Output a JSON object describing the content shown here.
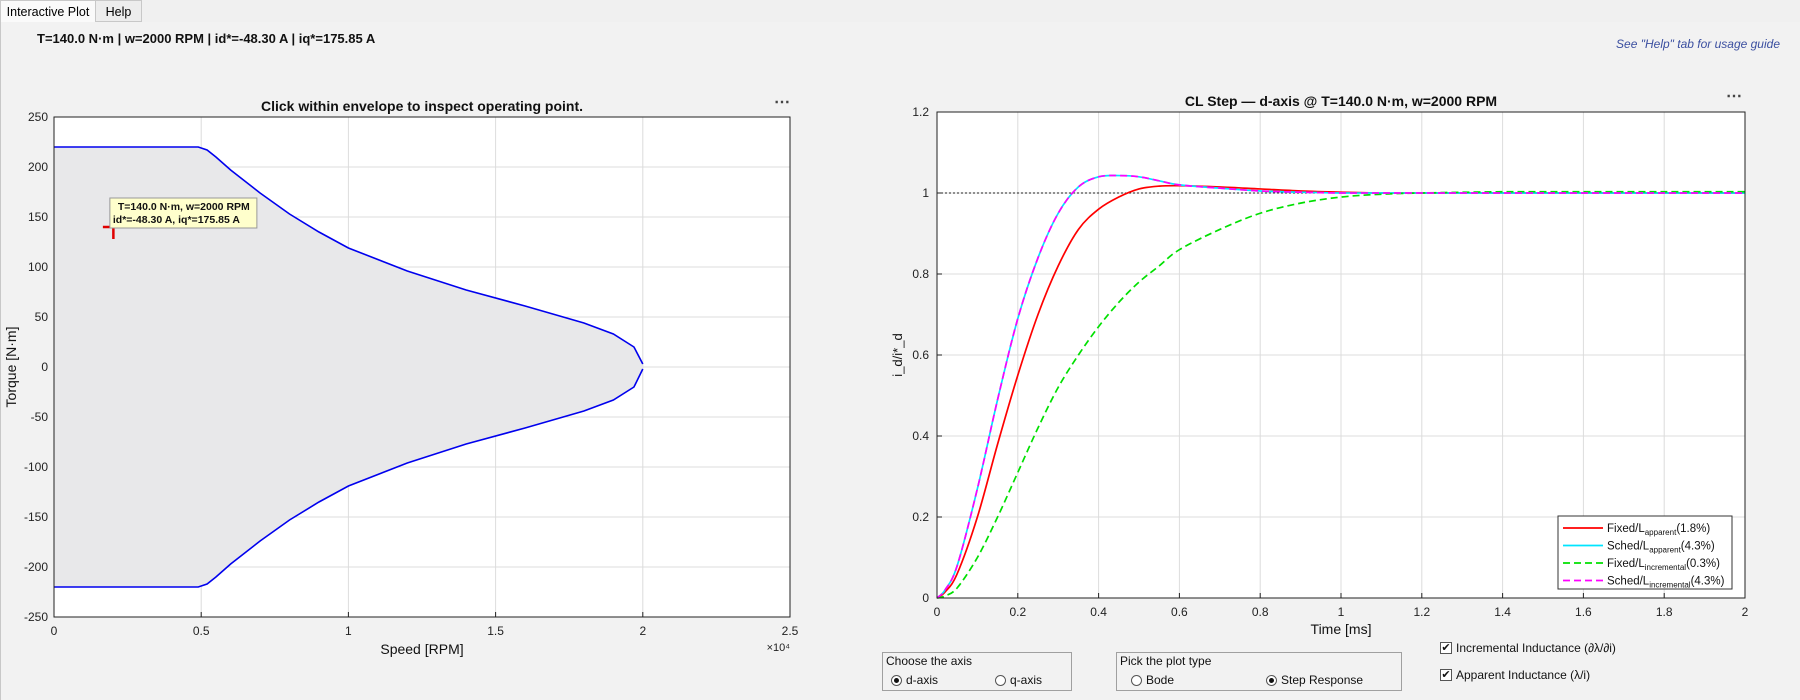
{
  "tabs": [
    {
      "label": "Interactive Plot"
    },
    {
      "label": "Help"
    }
  ],
  "status_line": "T=140.0 N·m  |  w=2000 RPM  |  id*=-48.30 A  |  iq*=175.85 A",
  "help_hint": "See \"Help\" tab for usage guide",
  "more_label": "⋯",
  "colors": {
    "envelope_fill": "#e8e8ea",
    "envelope_line": "#0000ee",
    "marker": "#e00000",
    "red": "#ff0000",
    "cyan": "#00e5ff",
    "green": "#00e000",
    "magenta": "#ff00ff",
    "tooltip_bg": "#ffffcc"
  },
  "tooltip": {
    "line1": "T=140.0 N·m, w=2000 RPM",
    "line2": "id*=-48.30 A, iq*=175.85 A"
  },
  "chart_data": [
    {
      "type": "area",
      "title": "Click within envelope to inspect operating point.",
      "xlabel": "Speed [RPM]",
      "ylabel": "Torque [N·m]",
      "x_exponent": "×10⁴",
      "xlim": [
        0,
        2.5
      ],
      "ylim": [
        -250,
        250
      ],
      "xticks": [
        0,
        0.5,
        1,
        1.5,
        2,
        2.5
      ],
      "xtick_labels": [
        "0",
        "0.5",
        "1",
        "1.5",
        "2",
        "2.5"
      ],
      "yticks": [
        250,
        200,
        150,
        100,
        50,
        0,
        -50,
        -100,
        -150,
        -200,
        -250
      ],
      "ytick_labels": [
        "250",
        "200",
        "150",
        "100",
        "50",
        "0",
        "-50",
        "-100",
        "-150",
        "-200",
        "-250"
      ],
      "grid": true,
      "envelope_upper": [
        [
          0,
          220
        ],
        [
          0.49,
          220
        ],
        [
          0.52,
          217
        ],
        [
          0.55,
          210
        ],
        [
          0.6,
          197
        ],
        [
          0.7,
          174
        ],
        [
          0.8,
          153
        ],
        [
          0.9,
          135
        ],
        [
          1.0,
          119
        ],
        [
          1.2,
          96
        ],
        [
          1.4,
          77
        ],
        [
          1.6,
          61
        ],
        [
          1.8,
          44
        ],
        [
          1.9,
          33
        ],
        [
          1.97,
          20
        ],
        [
          2.0,
          3
        ]
      ],
      "operating_point": {
        "speed": 2000,
        "torque": 140
      }
    },
    {
      "type": "line",
      "title": "CL Step — d-axis @ T=140.0 N·m, w=2000 RPM",
      "xlabel": "Time [ms]",
      "ylabel": "i_d/i*_d",
      "xlim": [
        0,
        2
      ],
      "ylim": [
        0,
        1.2
      ],
      "xticks": [
        0,
        0.2,
        0.4,
        0.6,
        0.8,
        1,
        1.2,
        1.4,
        1.6,
        1.8,
        2
      ],
      "xtick_labels": [
        "0",
        "0.2",
        "0.4",
        "0.6",
        "0.8",
        "1",
        "1.2",
        "1.4",
        "1.6",
        "1.8",
        "2"
      ],
      "yticks": [
        0,
        0.2,
        0.4,
        0.6,
        0.8,
        1,
        1.2
      ],
      "ytick_labels": [
        "0",
        "0.2",
        "0.4",
        "0.6",
        "0.8",
        "1",
        "1.2"
      ],
      "grid": true,
      "reference_line": 1,
      "legend_position": "bottom-right",
      "x": [
        0,
        0.02,
        0.05,
        0.1,
        0.15,
        0.2,
        0.25,
        0.3,
        0.35,
        0.4,
        0.45,
        0.5,
        0.55,
        0.6,
        0.7,
        0.8,
        0.9,
        1.0,
        1.1,
        1.2,
        1.4,
        1.6,
        1.8,
        2.0
      ],
      "series": [
        {
          "name": "Fixed/L",
          "sub": "apparent",
          "pct": "(1.8%)",
          "color": "red",
          "dash": "",
          "values": [
            0,
            0.015,
            0.06,
            0.2,
            0.38,
            0.55,
            0.7,
            0.82,
            0.91,
            0.96,
            0.99,
            1.01,
            1.017,
            1.018,
            1.015,
            1.01,
            1.005,
            1.002,
            1.0,
            1.0,
            1.0,
            1.0,
            1.0,
            1.0
          ]
        },
        {
          "name": "Sched/L",
          "sub": "apparent",
          "pct": "(4.3%)",
          "color": "cyan",
          "dash": "",
          "values": [
            0,
            0.02,
            0.08,
            0.27,
            0.49,
            0.69,
            0.84,
            0.95,
            1.015,
            1.04,
            1.043,
            1.04,
            1.03,
            1.02,
            1.012,
            1.005,
            1.002,
            1.0,
            1.0,
            1.0,
            1.0,
            1.0,
            1.0,
            1.0
          ]
        },
        {
          "name": "Fixed/L",
          "sub": "incremental",
          "pct": "(0.3%)",
          "color": "green",
          "dash": "7,4",
          "values": [
            0,
            0.005,
            0.025,
            0.1,
            0.2,
            0.31,
            0.42,
            0.52,
            0.6,
            0.67,
            0.73,
            0.78,
            0.82,
            0.86,
            0.91,
            0.95,
            0.975,
            0.99,
            0.997,
            1.0,
            1.003,
            1.003,
            1.003,
            1.003
          ]
        },
        {
          "name": "Sched/L",
          "sub": "incremental",
          "pct": "(4.3%)",
          "color": "magenta",
          "dash": "7,4",
          "values": [
            0,
            0.02,
            0.08,
            0.27,
            0.49,
            0.69,
            0.84,
            0.95,
            1.015,
            1.04,
            1.043,
            1.04,
            1.03,
            1.02,
            1.012,
            1.005,
            1.002,
            1.0,
            1.0,
            1.0,
            1.0,
            1.0,
            1.0,
            1.0
          ]
        }
      ]
    }
  ],
  "controls": {
    "axis_group": {
      "title": "Choose the axis",
      "options": [
        "d-axis",
        "q-axis"
      ],
      "selected": "d-axis"
    },
    "plot_group": {
      "title": "Pick the plot type",
      "options": [
        "Bode",
        "Step Response"
      ],
      "selected": "Step Response"
    },
    "checkboxes": [
      {
        "label": "Incremental Inductance (∂λ/∂i)",
        "checked": true
      },
      {
        "label": "Apparent Inductance (λ/i)",
        "checked": true
      }
    ],
    "check_mark": "✔"
  }
}
